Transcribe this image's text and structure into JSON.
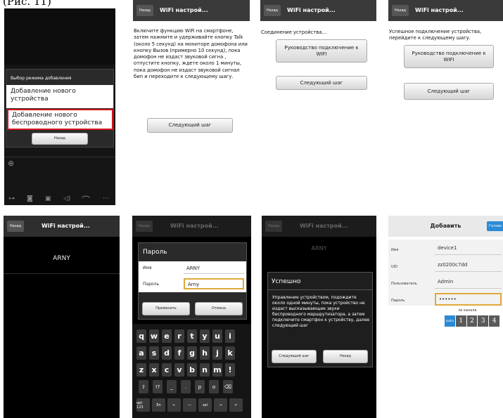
{
  "caption": "(Рис. 11)",
  "s1": {
    "dialog_title": "Выбор режима добавления",
    "opt1": "Добавление нового устройства",
    "opt2": "Добавление нового беспроводного устройства",
    "back": "Назад",
    "bottom_icons": [
      "key-icon",
      "camera-icon",
      "gallery-icon",
      "speaker-icon",
      "hangup-icon",
      "more-icon"
    ]
  },
  "s2": {
    "back": "Назад",
    "title": "WiFi настрой...",
    "text": "Включите функцию WiFi на смартфоне, затем нажмите и удерживайте кнопку Talk (около 5 секунд) на мониторе домофона или кнопку Вызов (примерно 10 секунд), пока домофон не издаст звуковой сигна , отпустите кнопку, ждете около 1 минуты, пока домофон не издаст звуковой сигнал бип и переходите к следующему шагу.",
    "next": "Следующий шаг"
  },
  "s3": {
    "back": "Назад",
    "title": "WiFi настрой...",
    "text": "Соединение устройства...",
    "guide": "Руководство подключение к WIFI",
    "next": "Следующий шаг"
  },
  "s4": {
    "back": "Назад",
    "title": "WiFi настрой...",
    "text": "Успешное подключение устройства, перейдите к следующему шагу.",
    "guide": "Руководство подключение к WIFI",
    "next": "Следующий шаг"
  },
  "s5": {
    "back": "Назад",
    "title": "WiFi настрой...",
    "network": "ARNY"
  },
  "s6": {
    "back": "Назад",
    "title": "WiFi настрой...",
    "dialog_title": "Пароль",
    "name_label": "Имя",
    "name_value": "ARNY",
    "pwd_label": "Пароль",
    "pwd_value": "Arny",
    "apply": "Применить",
    "cancel": "Отмена",
    "keys": [
      [
        "q",
        "w",
        "e",
        "r",
        "t",
        "y",
        "u",
        "i"
      ],
      [
        "a",
        "s",
        "d",
        "f",
        "g",
        "h",
        "j",
        "k"
      ],
      [
        "z",
        "x",
        "c",
        "v",
        "b",
        "n",
        "m",
        "!"
      ],
      [
        "⇧",
        "!?",
        "_",
        ".",
        "p",
        "o",
        "⌫"
      ]
    ],
    "bottom_keys": [
      "opt 123",
      "En",
      "←",
      "—",
      "sel",
      "→",
      "↵"
    ]
  },
  "s7": {
    "back": "Назад",
    "title": "WiFi настрой...",
    "network": "ARNY",
    "dialog_title": "Успешно",
    "text": "Управление устройством, подождите около одной минуты, пока устройство не издаст высказывающие звуки беспроводного маршрутизатора, а затем подключите смартфон к устройству, далее следующий шаг",
    "next": "Следующий шаг",
    "back2": "Назад"
  },
  "s8": {
    "title": "Добавить",
    "done": "Готово",
    "name_label": "Имя",
    "name_value": "device1",
    "uid_label": "UID",
    "uid_value": "zz0200c7dd",
    "user_label": "Пользователь",
    "user_value": "Admin",
    "pwd_label": "Пароль",
    "pwd_value": "••••••",
    "channel_label": "№ канала",
    "channels": [
      "auto",
      "1",
      "2",
      "3",
      "4"
    ]
  }
}
